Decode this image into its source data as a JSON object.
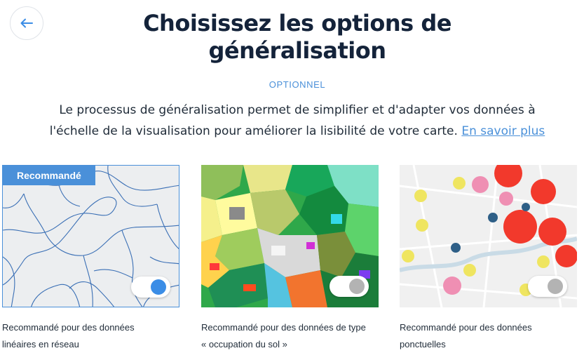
{
  "header": {
    "back_icon": "arrow-left-icon",
    "title": "Choisissez les options de généralisation",
    "optional_label": "OPTIONNEL"
  },
  "intro": {
    "text": "Le processus de généralisation permet de simplifier et d'adapter vos données à l'échelle de la visualisation pour améliorer la lisibilité de votre carte.",
    "link_label": "En savoir plus"
  },
  "colors": {
    "accent": "#4a90d9",
    "toggle_on": "#3b8de6",
    "toggle_off": "#b3b3b3"
  },
  "options": [
    {
      "badge": "Recommandé",
      "caption_line1": "Recommandé  pour des données",
      "caption_line2": "linéaires en réseau",
      "toggle_on": true
    },
    {
      "caption_line1": "Recommandé pour des données de type",
      "caption_line2": "« occupation du sol »",
      "toggle_on": false
    },
    {
      "caption_line1": "Recommandé pour des données",
      "caption_line2": "ponctuelles",
      "toggle_on": false
    }
  ]
}
